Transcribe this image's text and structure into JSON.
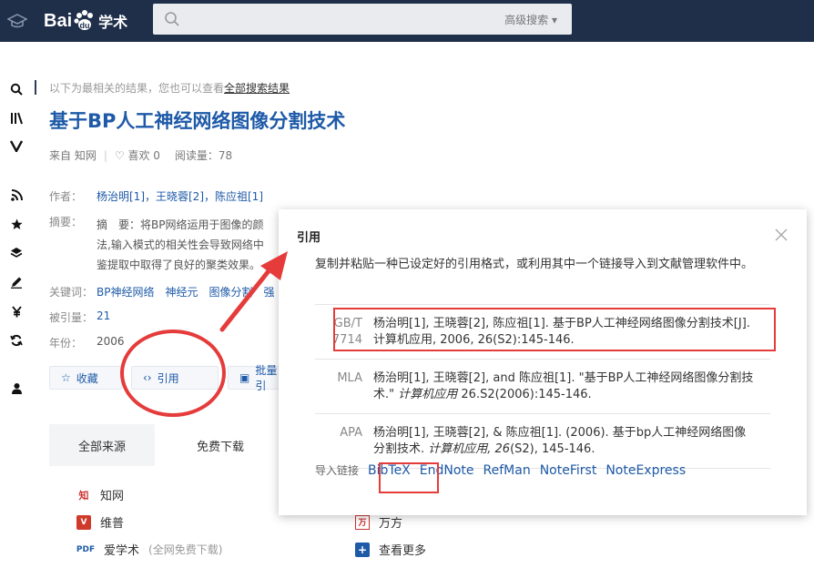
{
  "header": {
    "logo_left": "Bai",
    "logo_right": "学术",
    "advanced_search": "高级搜索"
  },
  "rail": {
    "icons": [
      "search-icon",
      "library-icon",
      "v-icon",
      "rss-icon",
      "star-icon",
      "layers-icon",
      "pen-icon",
      "yen-icon",
      "refresh-icon",
      "user-icon"
    ],
    "glyphs": [
      "⌕",
      "Ⅲ\\",
      "V",
      "≋",
      "★",
      "◈",
      "✎",
      "¥",
      "⟳",
      "●"
    ]
  },
  "page": {
    "hint_text": "以下为最相关的结果，您也可以查看",
    "hint_link": "全部搜索结果",
    "title": "基于BP人工神经网络图像分割技术",
    "source": "来自 知网",
    "likes": "喜欢 0",
    "reads": "阅读量：78",
    "author_label": "作者：",
    "authors": "杨治明[1]，王晓蓉[2]，陈应祖[1]",
    "abstract_label": "摘要：",
    "abstract_line1": "摘　要：将BP网络运用于图像的颜",
    "abstract_line2": "法,输入模式的相关性会导致网络中",
    "abstract_line3": "鉴提取中取得了良好的聚类效果。",
    "keywords_label": "关键词：",
    "keywords": "BP神经网络　神经元　图像分割　强",
    "cited_label": "被引量：",
    "cited": "21",
    "year_label": "年份：",
    "year": "2006",
    "btn_collect": "收藏",
    "btn_cite": "引用",
    "btn_batch": "批量引",
    "tab_all": "全部来源",
    "tab_free": "免费下载",
    "sources": [
      {
        "name": "知网",
        "icon": "cnki-icon"
      },
      {
        "name": "维普",
        "icon": "vip-icon"
      },
      {
        "name": "爱学术",
        "extra": "(全网免费下载)",
        "icon": "pdf-icon",
        "badge": "PDF"
      }
    ],
    "sources_right": [
      {
        "name": "万方",
        "icon": "wanfang-icon"
      },
      {
        "name": "查看更多",
        "icon": "plus-icon",
        "glyph": "+"
      }
    ]
  },
  "modal": {
    "title": "引用",
    "description": "复制并粘贴一种已设定好的引用格式，或利用其中一个链接导入到文献管理软件中。",
    "citations": [
      {
        "format": "GB/T 7714",
        "text": "杨治明[1], 王晓蓉[2], 陈应祖[1]. 基于BP人工神经网络图像分割技术[J]. 计算机应用, 2006, 26(S2):145-146."
      },
      {
        "format": "MLA",
        "text_pre": "杨治明[1], 王晓蓉[2], and 陈应祖[1]. \"基于BP人工神经网络图像分割技术.\" ",
        "text_italic": "计算机应用",
        "text_post": " 26.S2(2006):145-146."
      },
      {
        "format": "APA",
        "text_pre": "杨治明[1], 王晓蓉[2], & 陈应祖[1]. (2006). 基于bp人工神经网络图像分割技术. ",
        "text_italic": "计算机应用, 26",
        "text_post": "(S2), 145-146."
      }
    ],
    "import_label": "导入链接",
    "import_links": [
      "BibTeX",
      "EndNote",
      "RefMan",
      "NoteFirst",
      "NoteExpress"
    ]
  },
  "colors": {
    "header_bg": "#1f2f4a",
    "link_blue": "#1e5aa8",
    "annotation_red": "#e53b3b"
  }
}
